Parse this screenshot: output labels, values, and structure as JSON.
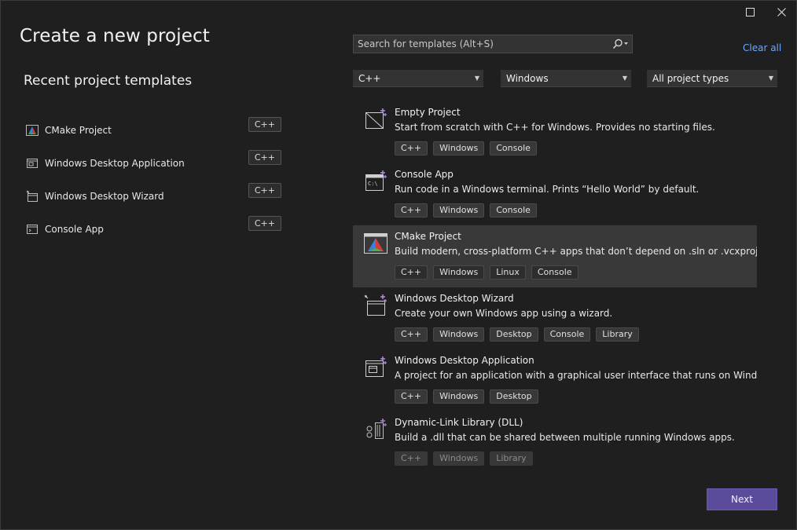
{
  "window": {
    "maximize_icon": "maximize-icon",
    "close_icon": "close-icon"
  },
  "title": "Create a new project",
  "recent": {
    "heading": "Recent project templates",
    "items": [
      {
        "label": "CMake Project",
        "tag": "C++",
        "icon": "cmake-icon"
      },
      {
        "label": "Windows Desktop Application",
        "tag": "C++",
        "icon": "desktop-app-icon"
      },
      {
        "label": "Windows Desktop Wizard",
        "tag": "C++",
        "icon": "wizard-icon"
      },
      {
        "label": "Console App",
        "tag": "C++",
        "icon": "console-icon"
      }
    ]
  },
  "search": {
    "placeholder": "Search for templates (Alt+S)",
    "icon": "search-icon"
  },
  "clear_all": "Clear all",
  "filters": {
    "language": "C++",
    "platform": "Windows",
    "project_type": "All project types"
  },
  "templates": [
    {
      "name": "Empty Project",
      "description": "Start from scratch with C++ for Windows. Provides no starting files.",
      "tags": [
        "C++",
        "Windows",
        "Console"
      ],
      "icon": "empty-project-icon"
    },
    {
      "name": "Console App",
      "description": "Run code in a Windows terminal. Prints “Hello World” by default.",
      "tags": [
        "C++",
        "Windows",
        "Console"
      ],
      "icon": "console-app-icon"
    },
    {
      "name": "CMake Project",
      "description": "Build modern, cross-platform C++ apps that don’t depend on .sln or .vcxproj files.",
      "tags": [
        "C++",
        "Windows",
        "Linux",
        "Console"
      ],
      "icon": "cmake-project-icon",
      "selected": true
    },
    {
      "name": "Windows Desktop Wizard",
      "description": "Create your own Windows app using a wizard.",
      "tags": [
        "C++",
        "Windows",
        "Desktop",
        "Console",
        "Library"
      ],
      "icon": "desktop-wizard-icon"
    },
    {
      "name": "Windows Desktop Application",
      "description": "A project for an application with a graphical user interface that runs on Windows.",
      "tags": [
        "C++",
        "Windows",
        "Desktop"
      ],
      "icon": "desktop-application-icon"
    },
    {
      "name": "Dynamic-Link Library (DLL)",
      "description": "Build a .dll that can be shared between multiple running Windows apps.",
      "tags": [
        "C++",
        "Windows",
        "Library"
      ],
      "icon": "dll-icon"
    }
  ],
  "next": "Next",
  "colors": {
    "background": "#1f1f1f",
    "accent_button": "#5c4b9b",
    "link": "#6ea8ff",
    "selected_row": "#393939"
  }
}
